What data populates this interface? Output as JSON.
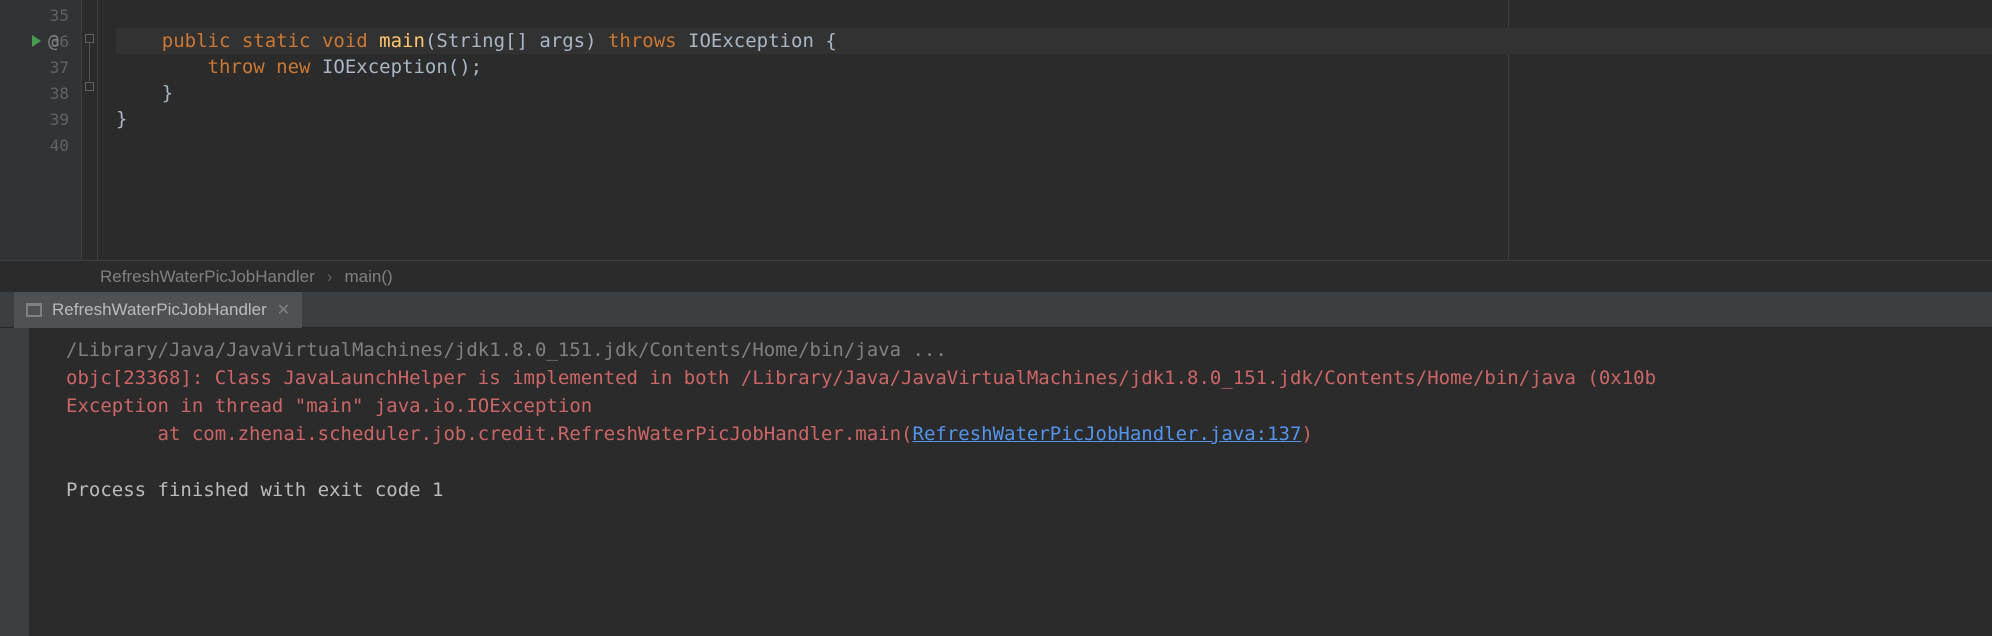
{
  "editor": {
    "line_numbers": [
      "35",
      "36",
      "37",
      "38",
      "39",
      "40"
    ],
    "at_label": "@",
    "code": {
      "l1_indent": "    ",
      "l1_kw_public": "public",
      "l1_kw_static": "static",
      "l1_kw_void": "void",
      "l1_method": "main",
      "l1_params": "(String[] args) ",
      "l1_kw_throws": "throws",
      "l1_exc": " IOException {",
      "l2_indent": "        ",
      "l2_kw_throw": "throw",
      "l2_kw_new": "new",
      "l2_rest": " IOException();",
      "l3": "    }",
      "l4": "}"
    }
  },
  "breadcrumb": {
    "class": "RefreshWaterPicJobHandler",
    "method": "main()"
  },
  "run_panel": {
    "tab": "RefreshWaterPicJobHandler",
    "console": {
      "cmd": "/Library/Java/JavaVirtualMachines/jdk1.8.0_151.jdk/Contents/Home/bin/java ...",
      "warn": "objc[23368]: Class JavaLaunchHelper is implemented in both /Library/Java/JavaVirtualMachines/jdk1.8.0_151.jdk/Contents/Home/bin/java (0x10b",
      "exc": "Exception in thread \"main\" java.io.IOException",
      "at_prefix": "\tat com.zhenai.scheduler.job.credit.RefreshWaterPicJobHandler.main(",
      "at_link": "RefreshWaterPicJobHandler.java:137",
      "at_suffix": ")",
      "exit": "Process finished with exit code 1"
    }
  }
}
